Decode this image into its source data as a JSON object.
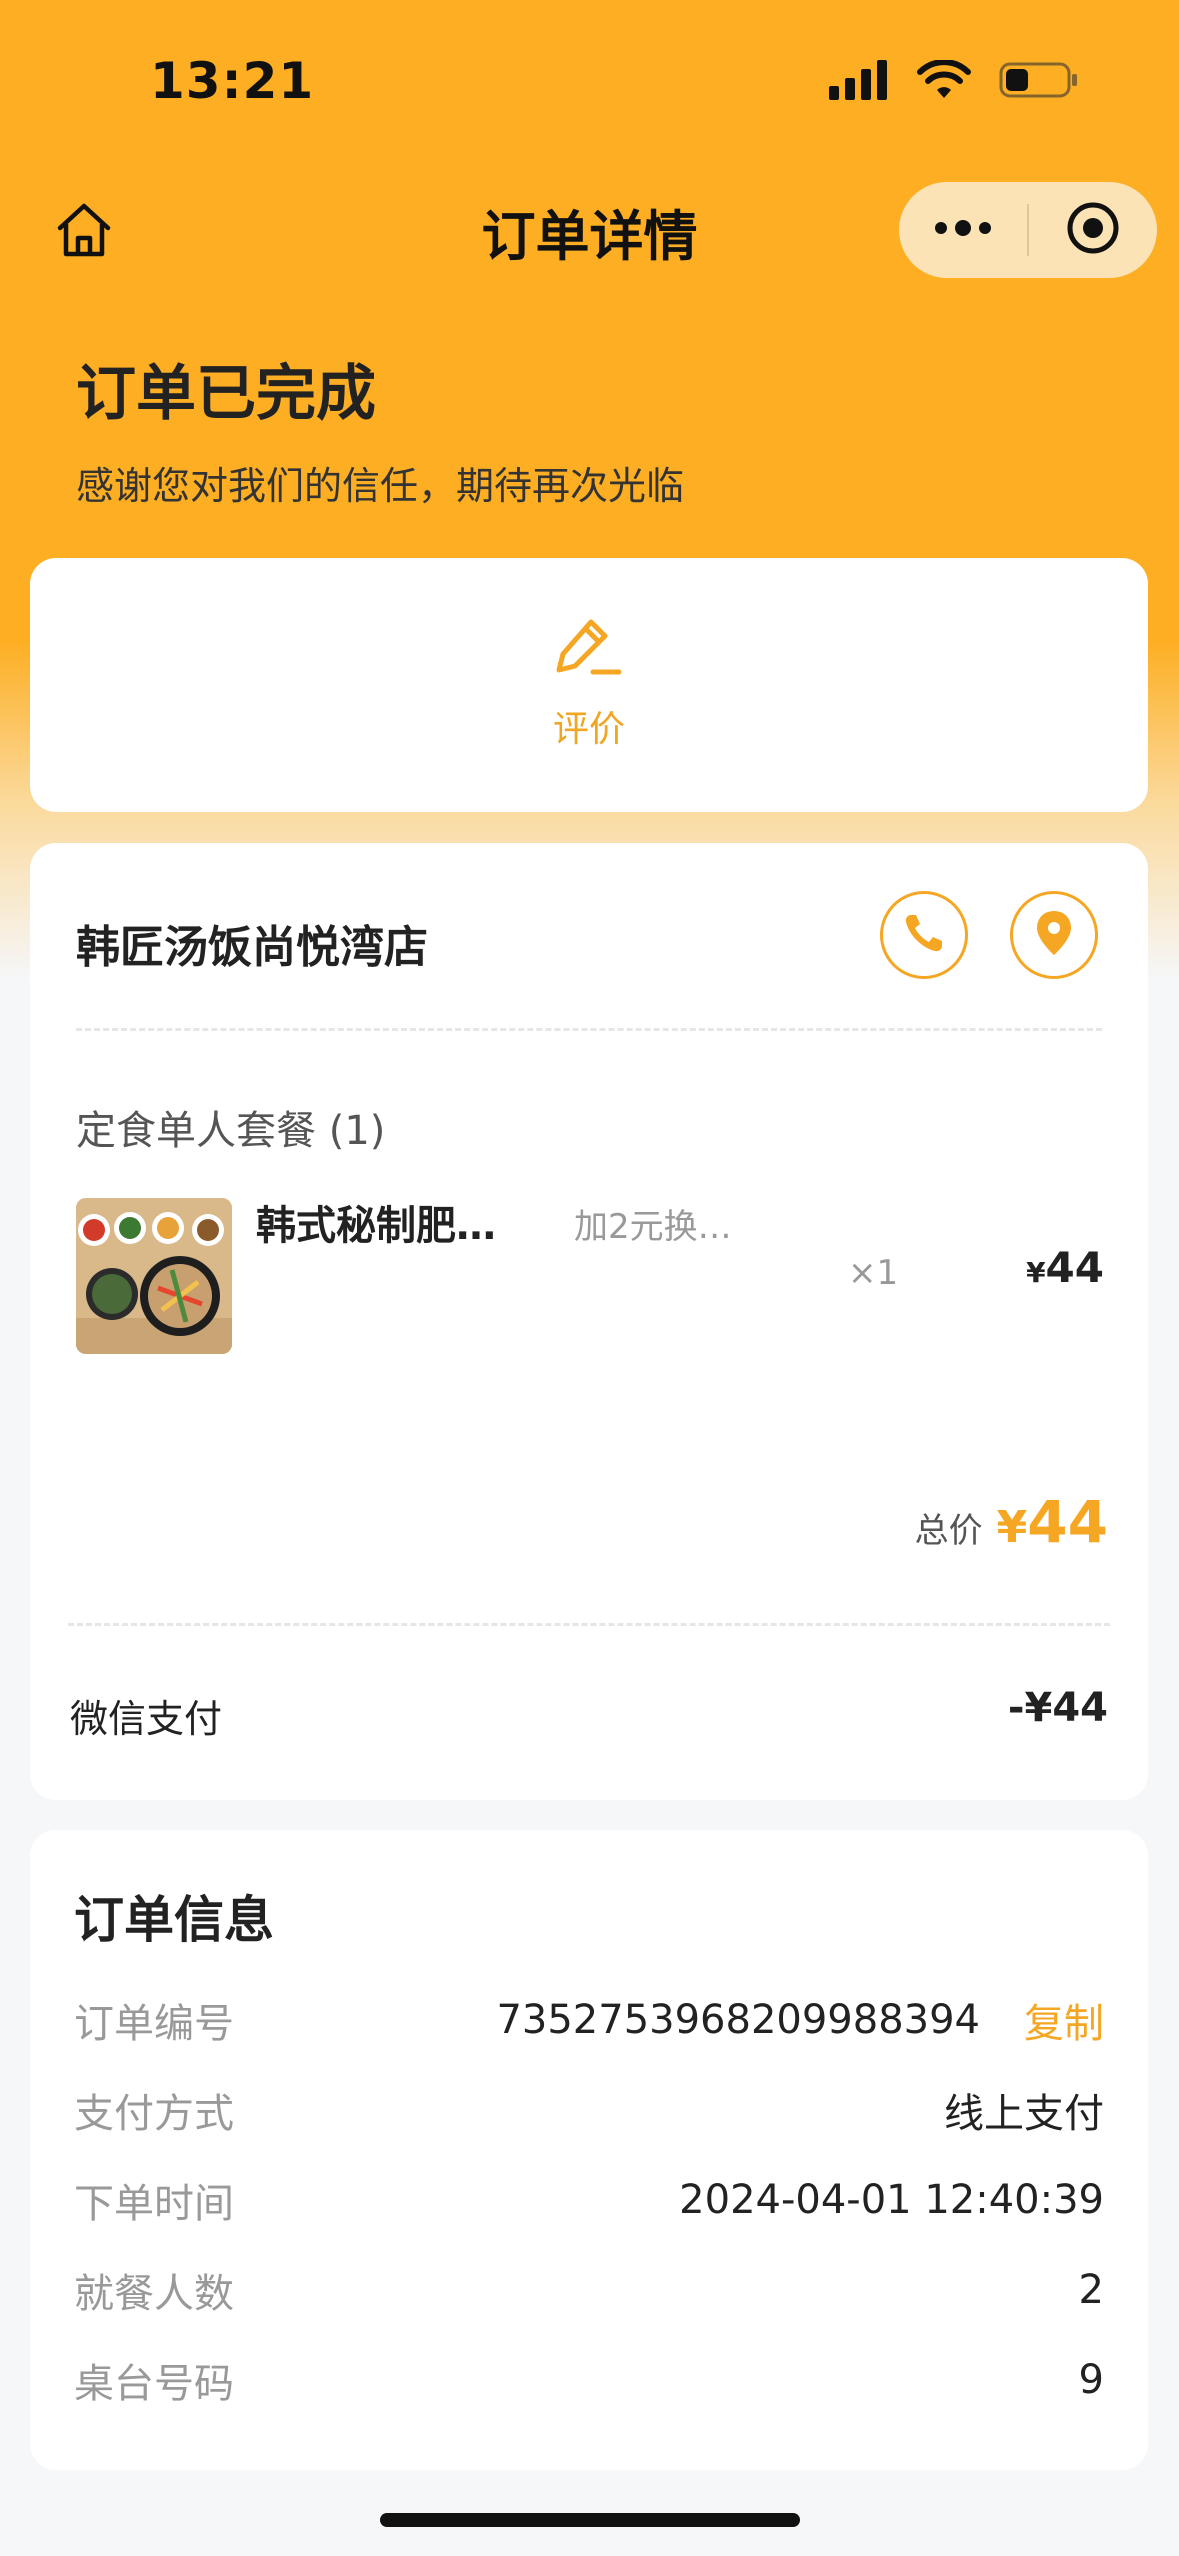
{
  "status_bar": {
    "time": "13:21"
  },
  "nav": {
    "title": "订单详情"
  },
  "order_status": {
    "title": "订单已完成",
    "subtitle": "感谢您对我们的信任，期待再次光临"
  },
  "review": {
    "label": "评价"
  },
  "shop": {
    "name": "韩匠汤饭尚悦湾店"
  },
  "order": {
    "set_title": "定食单人套餐 (1)",
    "item": {
      "name": "韩式秘制肥…",
      "option": "加2元换…",
      "qty": "×1",
      "currency": "¥",
      "price": "44"
    },
    "total_label": "总价",
    "total_currency": "¥",
    "total_value": "44",
    "payment_label": "微信支付",
    "payment_amount_prefix": "-¥",
    "payment_amount": "44"
  },
  "info": {
    "title": "订单信息",
    "order_no_label": "订单编号",
    "order_no": "7352753968209988394",
    "copy_label": "复制",
    "pay_method_label": "支付方式",
    "pay_method": "线上支付",
    "time_label": "下单时间",
    "time": "2024-04-01 12:40:39",
    "diners_label": "就餐人数",
    "diners": "2",
    "table_label": "桌台号码",
    "table": "9"
  },
  "colors": {
    "brand": "#FDAE22",
    "accent": "#F5A623",
    "background": "#F6F7F9"
  },
  "icons": [
    "home-icon",
    "more-icon",
    "target-icon",
    "edit-icon",
    "phone-icon",
    "location-icon",
    "signal-icon",
    "wifi-icon",
    "battery-icon"
  ]
}
